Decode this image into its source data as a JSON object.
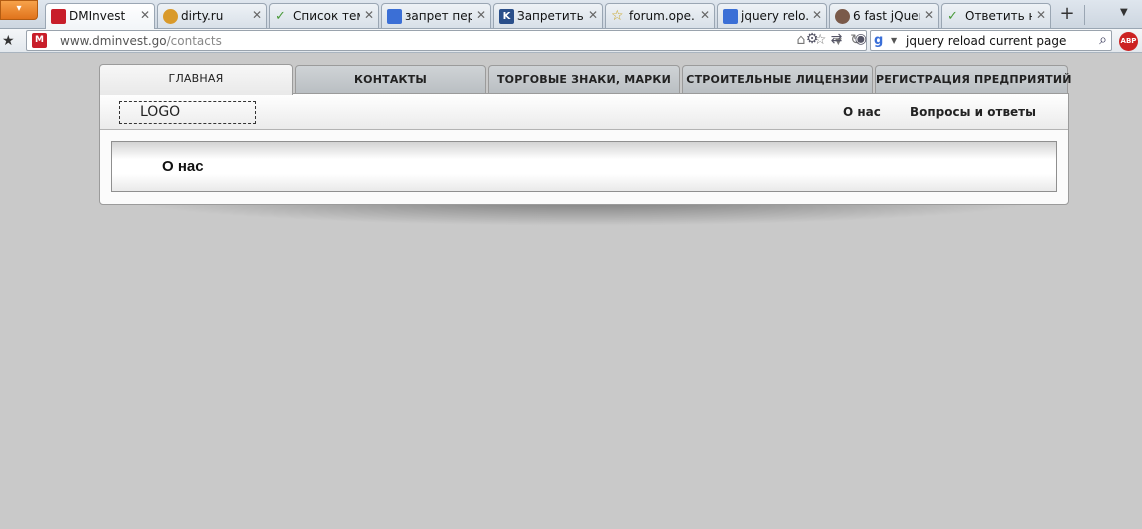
{
  "browser": {
    "menu_label": "▾",
    "tabs": [
      {
        "title": "DMInvest",
        "icon_color": "#c81e2a"
      },
      {
        "title": "dirty.ru",
        "icon_color": "#d99a2b"
      },
      {
        "title": "Список тем",
        "icon_color": "#4a9a3a"
      },
      {
        "title": "запрет пер...",
        "icon_color": "#3b6fd6"
      },
      {
        "title": "Запретить ...",
        "icon_color": "#2a4f8a"
      },
      {
        "title": "forum.ope...",
        "icon_color": "#e8c23a"
      },
      {
        "title": "jquery relo...",
        "icon_color": "#3b6fd6"
      },
      {
        "title": "6 fast jQuer...",
        "icon_color": "#7a5a4a"
      },
      {
        "title": "Ответить н...",
        "icon_color": "#4a9a3a"
      }
    ],
    "new_tab_label": "+",
    "url_host": "www.dminvest.go",
    "url_path": "/contacts",
    "favicon_text": "M",
    "search_query": "jquery reload current page",
    "search_engine_icon": "google-icon",
    "adblock_label": "ABP"
  },
  "site": {
    "nav_tabs": [
      {
        "label": "ГЛАВНАЯ"
      },
      {
        "label": "КОНТАКТЫ"
      },
      {
        "label": "ТОРГОВЫЕ ЗНАКИ, МАРКИ"
      },
      {
        "label": "СТРОИТЕЛЬНЫЕ ЛИЦЕНЗИИ"
      },
      {
        "label": "РЕГИСТРАЦИЯ ПРЕДПРИЯТИЙ"
      }
    ],
    "logo_text": "LOGO",
    "header_links": [
      {
        "label": "О нас"
      },
      {
        "label": "Вопросы и ответы"
      }
    ],
    "content_title": "О нас"
  },
  "colors": {
    "page_background": "#c9c9c9",
    "nav_tab_inactive": "#c2c6c9",
    "nav_tab_active": "#f2f2f2"
  }
}
